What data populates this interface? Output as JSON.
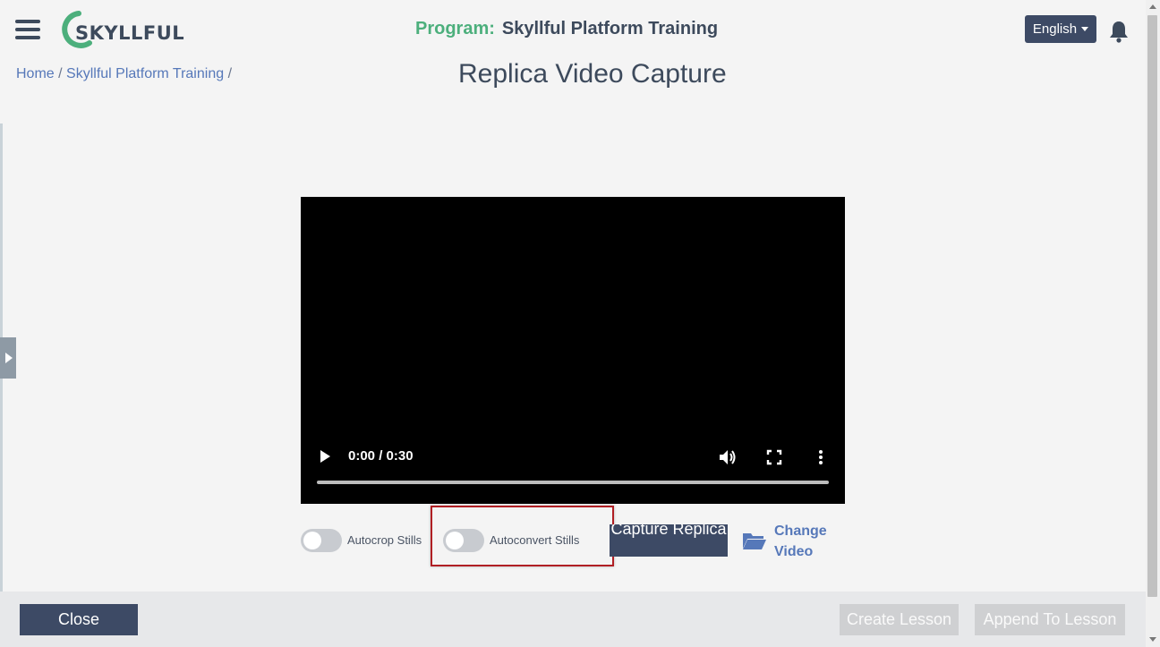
{
  "header": {
    "logo_text": "SKYLLFUL",
    "program_label": "Program:",
    "program_name": "Skyllful Platform Training",
    "language": "English"
  },
  "breadcrumb": {
    "items": [
      "Home",
      "Skyllful Platform Training"
    ],
    "separator": "/"
  },
  "page_title": "Replica Video Capture",
  "video": {
    "time": "0:00 / 0:30",
    "progress": 0
  },
  "controls": {
    "autocrop_label": "Autocrop Stills",
    "autocrop_on": false,
    "autoconvert_label": "Autoconvert Stills",
    "autoconvert_on": false,
    "capture_label": "Capture Replica",
    "change_video_label": "Change Video"
  },
  "footer": {
    "close_label": "Close",
    "create_lesson_label": "Create Lesson",
    "append_lesson_label": "Append To Lesson"
  },
  "colors": {
    "primary": "#3d4a65",
    "accent_green": "#4caf7c",
    "link": "#5678b9",
    "highlight": "#b01f24"
  }
}
